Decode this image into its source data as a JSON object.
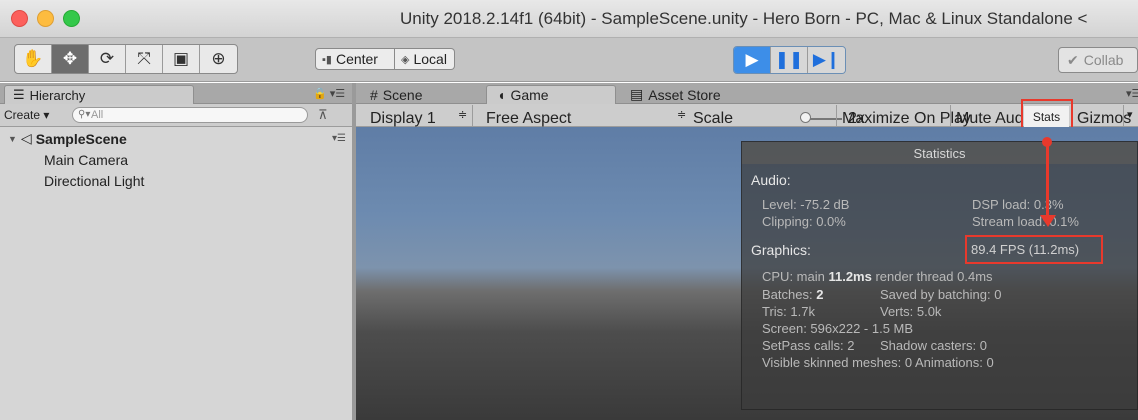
{
  "window": {
    "title": "Unity 2018.2.14f1 (64bit) - SampleScene.unity - Hero Born - PC, Mac & Linux Standalone <"
  },
  "toolbar": {
    "tools": [
      {
        "name": "hand-tool",
        "icon": "hand-icon"
      },
      {
        "name": "move-tool",
        "icon": "move-arrows-icon"
      },
      {
        "name": "rotate-tool",
        "icon": "rotate-icon"
      },
      {
        "name": "scale-tool",
        "icon": "scale-icon"
      },
      {
        "name": "rect-tool",
        "icon": "rect-icon"
      },
      {
        "name": "transform-tool",
        "icon": "transform-icon"
      }
    ],
    "pivot_mode": "Center",
    "pivot_rotation": "Local",
    "collab": "Collab"
  },
  "hierarchy": {
    "tab_label": "Hierarchy",
    "create_label": "Create",
    "search_placeholder": "All",
    "scene_name": "SampleScene",
    "items": [
      "Main Camera",
      "Directional Light"
    ]
  },
  "view_tabs": {
    "scene": "Scene",
    "game": "Game",
    "asset_store": "Asset Store"
  },
  "game_toolbar": {
    "display": "Display 1",
    "aspect": "Free Aspect",
    "scale_label": "Scale",
    "scale_value": "2x",
    "maximize": "Maximize On Play",
    "mute": "Mute Audio",
    "stats": "Stats",
    "gizmos": "Gizmos"
  },
  "stats": {
    "title": "Statistics",
    "audio_head": "Audio:",
    "level": "Level: -75.2 dB",
    "clipping": "Clipping: 0.0%",
    "dsp_load": "DSP load: 0.3%",
    "stream_load": "Stream load: 0.1%",
    "graphics_head": "Graphics:",
    "fps": "89.4 FPS (11.2ms)",
    "cpu_prefix": "CPU: main ",
    "cpu_main": "11.2ms",
    "cpu_render": " render thread 0.4ms",
    "batches_prefix": "Batches: ",
    "batches": "2",
    "saved_batching": "Saved by batching: 0",
    "tris": "Tris: 1.7k",
    "verts": "Verts: 5.0k",
    "screen": "Screen: 596x222 - 1.5 MB",
    "setpass": "SetPass calls: 2",
    "shadow": "Shadow casters: 0",
    "skinned": "Visible skinned meshes: 0  Animations: 0"
  },
  "colors": {
    "highlight": "#e8392c",
    "play_blue": "#3d8ee8"
  }
}
